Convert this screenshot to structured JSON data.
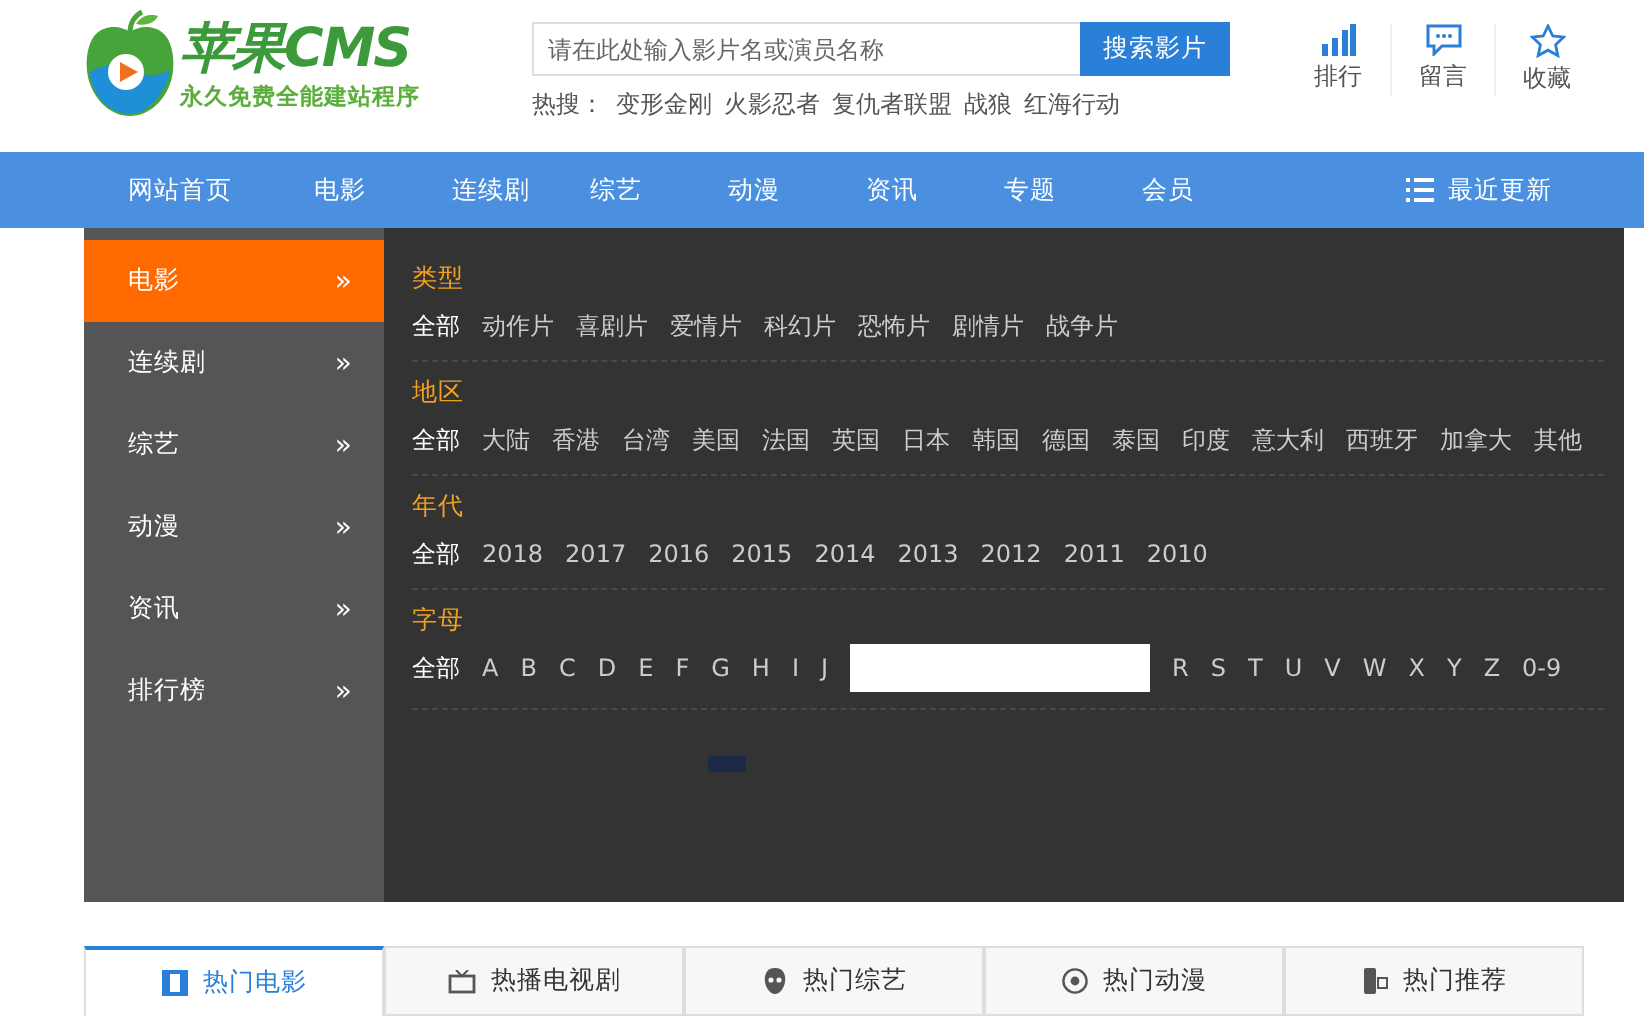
{
  "logo": {
    "title": "苹果CMS",
    "slogan": "永久免费全能建站程序"
  },
  "search": {
    "placeholder": "请在此处输入影片名或演员名称",
    "button": "搜索影片"
  },
  "hot_search": {
    "label": "热搜：",
    "terms": [
      "变形金刚",
      "火影忍者",
      "复仇者联盟",
      "战狼",
      "红海行动"
    ]
  },
  "header_actions": [
    {
      "kind": "bars",
      "label": "排行"
    },
    {
      "kind": "chat",
      "label": "留言"
    },
    {
      "kind": "star",
      "label": "收藏"
    }
  ],
  "nav": {
    "items": [
      "网站首页",
      "电影",
      "连续剧",
      "综艺",
      "动漫",
      "资讯",
      "专题",
      "会员"
    ],
    "recent": "最近更新"
  },
  "sidebar": [
    {
      "label": "电影",
      "arrow": "»",
      "selected": true
    },
    {
      "label": "连续剧",
      "arrow": "»",
      "selected": false
    },
    {
      "label": "综艺",
      "arrow": "»",
      "selected": false
    },
    {
      "label": "动漫",
      "arrow": "»",
      "selected": false
    },
    {
      "label": "资讯",
      "arrow": "»",
      "selected": false
    },
    {
      "label": "排行榜",
      "arrow": "»",
      "selected": false
    }
  ],
  "filters": [
    {
      "title": "类型",
      "options": [
        {
          "kind": "text",
          "label": "全部",
          "selected": true
        },
        {
          "kind": "text",
          "label": "动作片",
          "selected": false
        },
        {
          "kind": "text",
          "label": "喜剧片",
          "selected": false
        },
        {
          "kind": "text",
          "label": "爱情片",
          "selected": false
        },
        {
          "kind": "text",
          "label": "科幻片",
          "selected": false
        },
        {
          "kind": "text",
          "label": "恐怖片",
          "selected": false
        },
        {
          "kind": "text",
          "label": "剧情片",
          "selected": false
        },
        {
          "kind": "text",
          "label": "战争片",
          "selected": false
        }
      ]
    },
    {
      "title": "地区",
      "options": [
        {
          "kind": "text",
          "label": "全部",
          "selected": true
        },
        {
          "kind": "text",
          "label": "大陆",
          "selected": false
        },
        {
          "kind": "text",
          "label": "香港",
          "selected": false
        },
        {
          "kind": "text",
          "label": "台湾",
          "selected": false
        },
        {
          "kind": "text",
          "label": "美国",
          "selected": false
        },
        {
          "kind": "text",
          "label": "法国",
          "selected": false
        },
        {
          "kind": "text",
          "label": "英国",
          "selected": false
        },
        {
          "kind": "text",
          "label": "日本",
          "selected": false
        },
        {
          "kind": "text",
          "label": "韩国",
          "selected": false
        },
        {
          "kind": "text",
          "label": "德国",
          "selected": false
        },
        {
          "kind": "text",
          "label": "泰国",
          "selected": false
        },
        {
          "kind": "text",
          "label": "印度",
          "selected": false
        },
        {
          "kind": "text",
          "label": "意大利",
          "selected": false
        },
        {
          "kind": "text",
          "label": "西班牙",
          "selected": false
        },
        {
          "kind": "text",
          "label": "加拿大",
          "selected": false
        },
        {
          "kind": "text",
          "label": "其他",
          "selected": false
        }
      ]
    },
    {
      "title": "年代",
      "options": [
        {
          "kind": "text",
          "label": "全部",
          "selected": true
        },
        {
          "kind": "text",
          "label": "2018",
          "selected": false
        },
        {
          "kind": "text",
          "label": "2017",
          "selected": false
        },
        {
          "kind": "text",
          "label": "2016",
          "selected": false
        },
        {
          "kind": "text",
          "label": "2015",
          "selected": false
        },
        {
          "kind": "text",
          "label": "2014",
          "selected": false
        },
        {
          "kind": "text",
          "label": "2013",
          "selected": false
        },
        {
          "kind": "text",
          "label": "2012",
          "selected": false
        },
        {
          "kind": "text",
          "label": "2011",
          "selected": false
        },
        {
          "kind": "text",
          "label": "2010",
          "selected": false
        }
      ]
    },
    {
      "title": "字母",
      "options": [
        {
          "kind": "text",
          "label": "全部",
          "selected": true
        },
        {
          "kind": "text",
          "label": "A",
          "selected": false
        },
        {
          "kind": "text",
          "label": "B",
          "selected": false
        },
        {
          "kind": "text",
          "label": "C",
          "selected": false
        },
        {
          "kind": "text",
          "label": "D",
          "selected": false
        },
        {
          "kind": "text",
          "label": "E",
          "selected": false
        },
        {
          "kind": "text",
          "label": "F",
          "selected": false
        },
        {
          "kind": "text",
          "label": "G",
          "selected": false
        },
        {
          "kind": "text",
          "label": "H",
          "selected": false
        },
        {
          "kind": "text",
          "label": "I",
          "selected": false
        },
        {
          "kind": "text",
          "label": "J",
          "selected": false
        },
        {
          "kind": "mask"
        },
        {
          "kind": "text",
          "label": "R",
          "selected": false
        },
        {
          "kind": "text",
          "label": "S",
          "selected": false
        },
        {
          "kind": "text",
          "label": "T",
          "selected": false
        },
        {
          "kind": "text",
          "label": "U",
          "selected": false
        },
        {
          "kind": "text",
          "label": "V",
          "selected": false
        },
        {
          "kind": "text",
          "label": "W",
          "selected": false
        },
        {
          "kind": "text",
          "label": "X",
          "selected": false
        },
        {
          "kind": "text",
          "label": "Y",
          "selected": false
        },
        {
          "kind": "text",
          "label": "Z",
          "selected": false
        },
        {
          "kind": "text",
          "label": "0-9",
          "selected": false
        }
      ]
    }
  ],
  "tabs": [
    {
      "kind": "film",
      "label": "热门电影",
      "selected": true
    },
    {
      "kind": "tv",
      "label": "热播电视剧",
      "selected": false
    },
    {
      "kind": "mask",
      "label": "热门综艺",
      "selected": false
    },
    {
      "kind": "disc",
      "label": "热门动漫",
      "selected": false
    },
    {
      "kind": "phone",
      "label": "热门推荐",
      "selected": false
    }
  ]
}
